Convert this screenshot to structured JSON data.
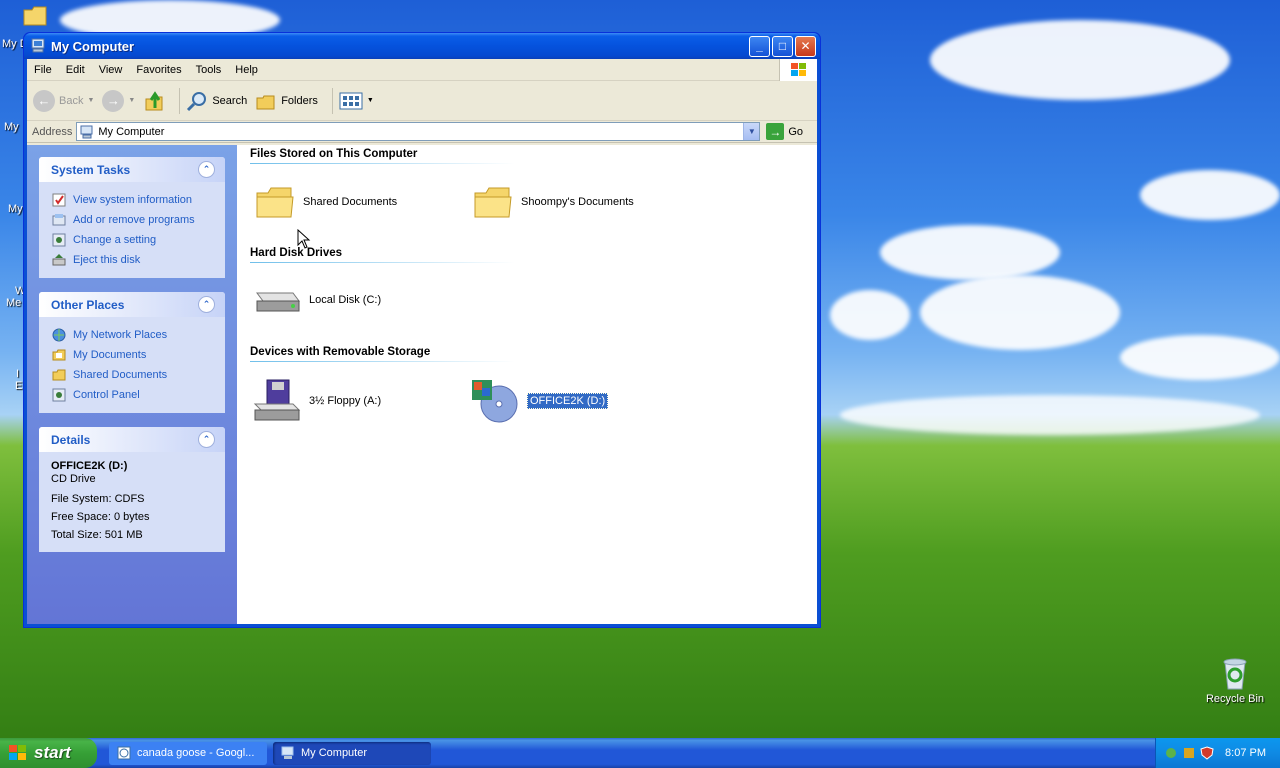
{
  "window": {
    "title": "My Computer",
    "menu": [
      "File",
      "Edit",
      "View",
      "Favorites",
      "Tools",
      "Help"
    ],
    "toolbar": {
      "back": "Back",
      "search": "Search",
      "folders": "Folders"
    },
    "address": {
      "label": "Address",
      "value": "My Computer",
      "go": "Go"
    }
  },
  "taskpane": {
    "system_tasks": {
      "title": "System Tasks",
      "items": [
        "View system information",
        "Add or remove programs",
        "Change a setting",
        "Eject this disk"
      ]
    },
    "other_places": {
      "title": "Other Places",
      "items": [
        "My Network Places",
        "My Documents",
        "Shared Documents",
        "Control Panel"
      ]
    },
    "details": {
      "title": "Details",
      "name": "OFFICE2K (D:)",
      "type": "CD Drive",
      "file_system": "File System: CDFS",
      "free_space": "Free Space: 0 bytes",
      "total_size": "Total Size: 501 MB"
    }
  },
  "main": {
    "groups": [
      {
        "title": "Files Stored on This Computer",
        "items": [
          "Shared Documents",
          "Shoompy's Documents"
        ]
      },
      {
        "title": "Hard Disk Drives",
        "items": [
          "Local Disk (C:)"
        ]
      },
      {
        "title": "Devices with Removable Storage",
        "items": [
          "3½ Floppy (A:)",
          "OFFICE2K (D:)"
        ]
      }
    ]
  },
  "desktop": {
    "recycle_bin": "Recycle Bin",
    "partial_labels": [
      "My D",
      "My",
      "My",
      "W",
      "Me",
      "I",
      "E"
    ]
  },
  "taskbar": {
    "start": "start",
    "tasks": [
      "canada goose - Googl...",
      "My Computer"
    ],
    "clock": "8:07 PM"
  },
  "colors": {
    "xp_blue": "#0a5ee8",
    "link_blue": "#215dc6",
    "selection": "#316ac5",
    "start_green": "#36a036"
  }
}
